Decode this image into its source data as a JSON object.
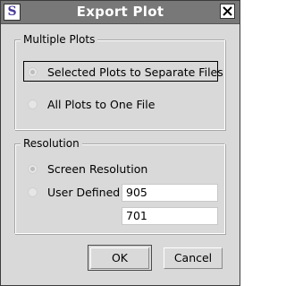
{
  "window": {
    "title": "Export Plot",
    "app_icon_letter": "S"
  },
  "multiple_plots": {
    "legend": "Multiple Plots",
    "options": [
      {
        "label": "Selected Plots to Separate Files",
        "selected": true
      },
      {
        "label": "All Plots to One File",
        "selected": false
      }
    ]
  },
  "resolution": {
    "legend": "Resolution",
    "options": [
      {
        "label": "Screen Resolution",
        "selected": true
      },
      {
        "label": "User Defined",
        "selected": false
      }
    ],
    "width_value": "905",
    "height_value": "701"
  },
  "buttons": {
    "ok_label": "OK",
    "cancel_label": "Cancel"
  },
  "colors": {
    "titlebar": "#787878",
    "dialog_background": "#d9d9d9",
    "icon_letter": "#4a3b9a"
  }
}
